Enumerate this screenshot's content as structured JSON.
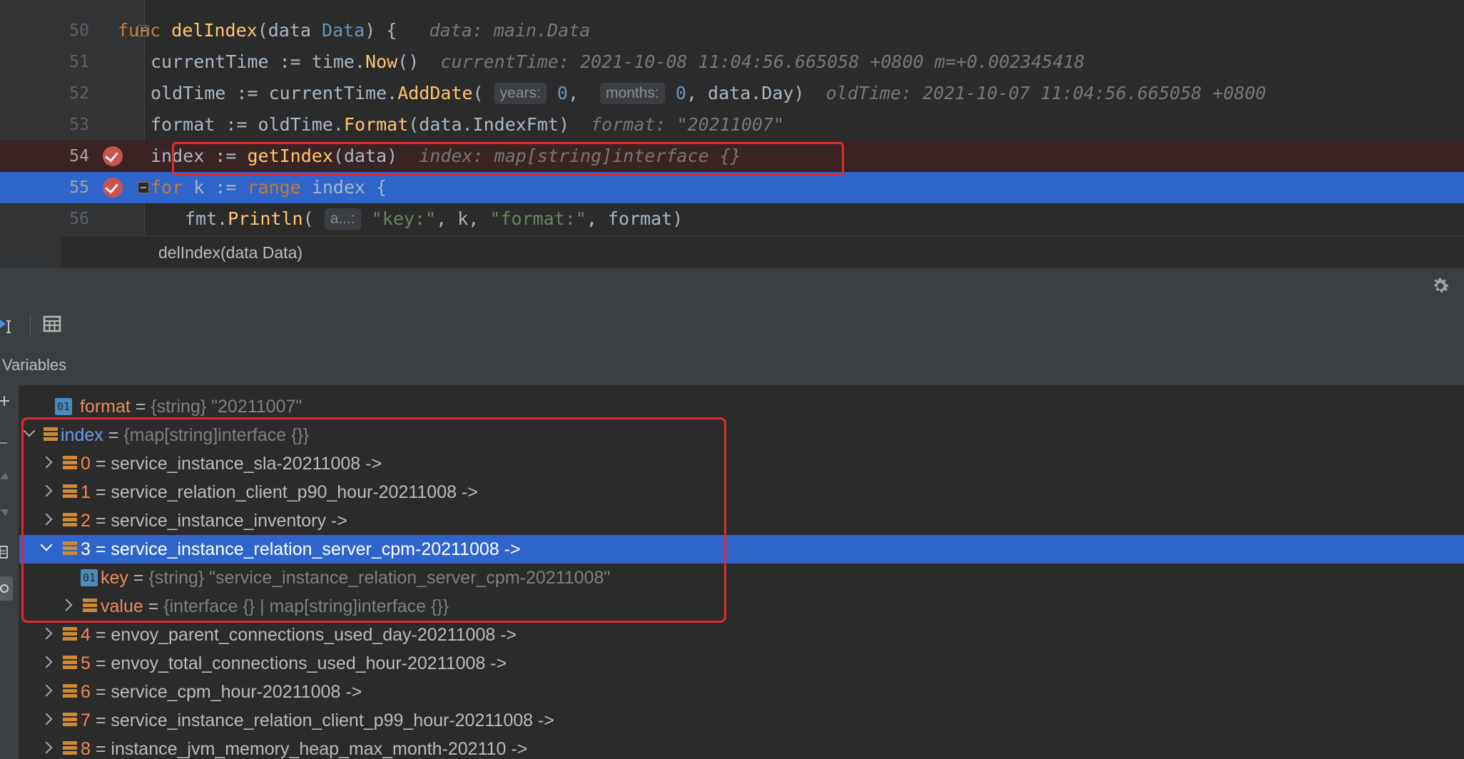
{
  "editor": {
    "lines": [
      {
        "num": "50",
        "text": "func delIndex(data Data) {",
        "inline": "data: main.Data"
      },
      {
        "num": "51",
        "text": "currentTime := time.Now()",
        "inline": "currentTime: 2021-10-08 11:04:56.665058 +0800 m=+0.002345418"
      },
      {
        "num": "52",
        "text": "oldTime := currentTime.AddDate(years: 0, months: 0, data.Day)",
        "inline": "oldTime: 2021-10-07 11:04:56.665058 +0800",
        "hint_years": "years:",
        "hint_months": "months:"
      },
      {
        "num": "53",
        "text": "format := oldTime.Format(data.IndexFmt)",
        "inline": "format: \"20211007\""
      },
      {
        "num": "54",
        "text": "index := getIndex(data)",
        "inline": "index: map[string]interface {}",
        "breakpoint": true
      },
      {
        "num": "55",
        "text": "for k := range index {",
        "breakpoint": true,
        "current": true
      },
      {
        "num": "56",
        "text": "fmt.Println(a...: \"key:\", k, \"format:\", format)",
        "hint_a": "a...:"
      }
    ],
    "breadcrumb": "delIndex(data Data)"
  },
  "panel": {
    "variables_title": "Variables",
    "icons": [
      "gear-icon",
      "table-icon",
      "restore-layout-icon"
    ]
  },
  "variables": [
    {
      "indent": 0,
      "expand": "none",
      "icon": "string",
      "name": "format",
      "eq": " = ",
      "value": "{string} \"20211007\""
    },
    {
      "indent": 0,
      "expand": "open",
      "icon": "map",
      "name": "index",
      "eq": " = ",
      "value": "{map[string]interface {}}"
    },
    {
      "indent": 1,
      "expand": "closed",
      "icon": "map",
      "name": "0",
      "eq": " = ",
      "value": "service_instance_sla-20211008 ->"
    },
    {
      "indent": 1,
      "expand": "closed",
      "icon": "map",
      "name": "1",
      "eq": " = ",
      "value": "service_relation_client_p90_hour-20211008 ->"
    },
    {
      "indent": 1,
      "expand": "closed",
      "icon": "map",
      "name": "2",
      "eq": " = ",
      "value": "service_instance_inventory ->"
    },
    {
      "indent": 1,
      "expand": "open",
      "icon": "map",
      "name": "3",
      "eq": " = ",
      "value": "service_instance_relation_server_cpm-20211008 ->",
      "selected": true
    },
    {
      "indent": 2,
      "expand": "none",
      "icon": "string",
      "name": "key",
      "eq": " = ",
      "value": "{string} \"service_instance_relation_server_cpm-20211008\""
    },
    {
      "indent": 2,
      "expand": "closed",
      "icon": "map",
      "name": "value",
      "eq": " = ",
      "value": "{interface {} | map[string]interface {}}"
    },
    {
      "indent": 1,
      "expand": "closed",
      "icon": "map",
      "name": "4",
      "eq": " = ",
      "value": "envoy_parent_connections_used_day-20211008 ->"
    },
    {
      "indent": 1,
      "expand": "closed",
      "icon": "map",
      "name": "5",
      "eq": " = ",
      "value": "envoy_total_connections_used_hour-20211008 ->"
    },
    {
      "indent": 1,
      "expand": "closed",
      "icon": "map",
      "name": "6",
      "eq": " = ",
      "value": "service_cpm_hour-20211008 ->"
    },
    {
      "indent": 1,
      "expand": "closed",
      "icon": "map",
      "name": "7",
      "eq": " = ",
      "value": "service_instance_relation_client_p99_hour-20211008 ->"
    },
    {
      "indent": 1,
      "expand": "closed",
      "icon": "map",
      "name": "8",
      "eq": " = ",
      "value": "instance_jvm_memory_heap_max_month-202110 ->"
    }
  ],
  "colors": {
    "current_line": "#2f65ca",
    "breakpoint_line": "#3a2323",
    "annotation_red": "#e0282e",
    "keyword": "#cc7832",
    "function": "#ffc66d",
    "variable_name": "#ee8a5c"
  }
}
